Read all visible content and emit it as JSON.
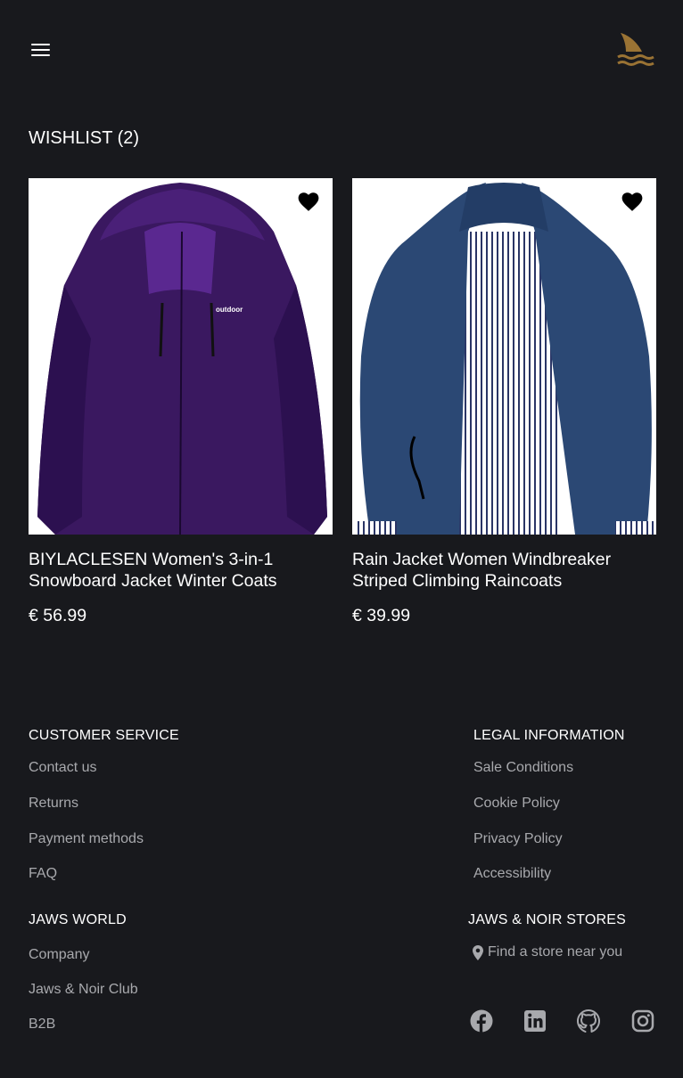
{
  "header": {
    "menu_icon": "hamburger-menu-icon",
    "logo_icon": "shark-fin-waves-logo",
    "accent_color": "#9a7334"
  },
  "wishlist": {
    "title": "WISHLIST (2)",
    "items": [
      {
        "name": "BIYLACLESEN Women's 3-in-1 Snowboard Jacket Winter Coats",
        "price": "€ 56.99",
        "image": "purple-jacket-image",
        "favorite_icon": "heart-filled-icon"
      },
      {
        "name": "Rain Jacket Women Windbreaker Striped Climbing Raincoats",
        "price": "€ 39.99",
        "image": "navy-rain-jacket-image",
        "favorite_icon": "heart-filled-icon"
      }
    ]
  },
  "footer": {
    "customer_service": {
      "title": "CUSTOMER SERVICE",
      "links": [
        "Contact us",
        "Returns",
        "Payment methods",
        "FAQ"
      ]
    },
    "legal": {
      "title": "LEGAL INFORMATION",
      "links": [
        "Sale Conditions",
        "Cookie Policy",
        "Privacy Policy",
        "Accessibility"
      ]
    },
    "jaws_world": {
      "title": "JAWS WORLD",
      "links": [
        "Company",
        "Jaws & Noir Club",
        "B2B"
      ]
    },
    "stores": {
      "title": "JAWS & NOIR STORES",
      "find_store": "Find a store near you",
      "find_icon": "map-pin-icon"
    },
    "social": [
      "facebook-icon",
      "linkedin-icon",
      "github-icon",
      "instagram-icon"
    ]
  }
}
